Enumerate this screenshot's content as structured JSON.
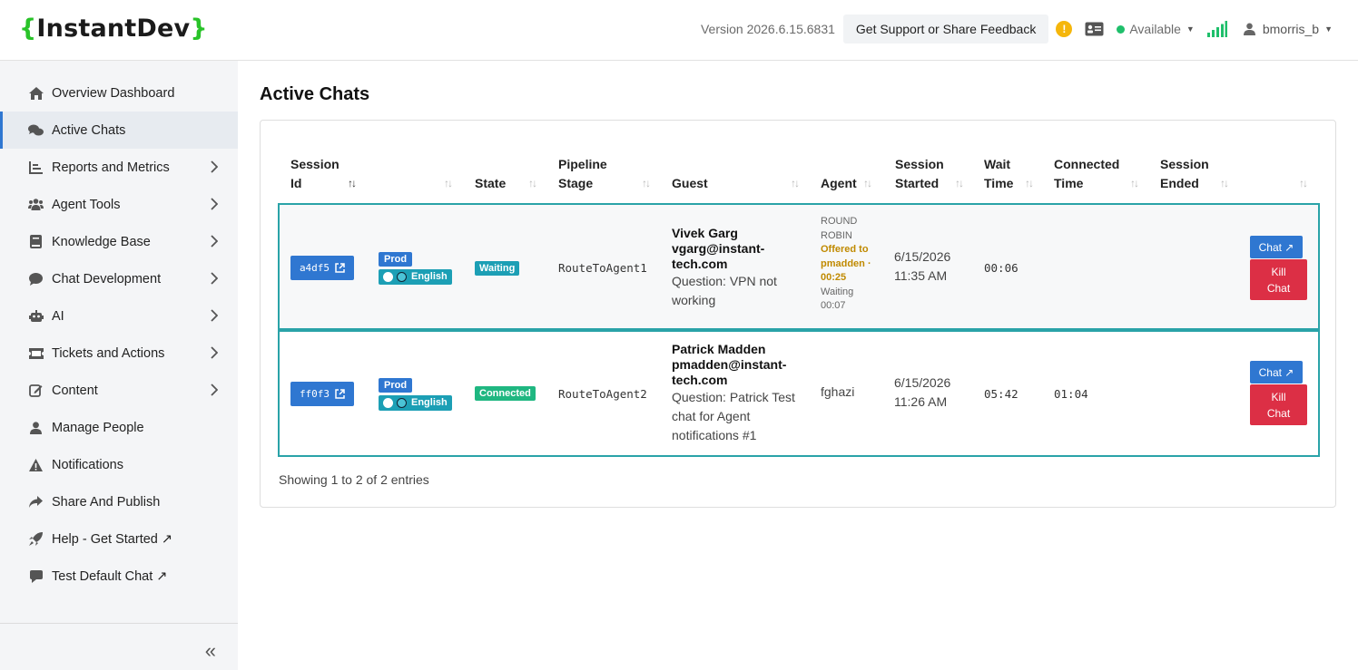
{
  "header": {
    "logo_open": "{",
    "logo_text": "InstantDev",
    "logo_close": "}",
    "version": "Version 2026.6.15.6831",
    "support_label": "Get Support or Share Feedback",
    "warn_glyph": "!",
    "status_label": "Available",
    "username": "bmorris_b",
    "colors": {
      "status_dot": "#1fbf6b",
      "warning": "#f5b60b",
      "signal": "#1fbf6b"
    }
  },
  "sidebar": {
    "items": [
      {
        "label": "Overview Dashboard",
        "icon": "home-icon"
      },
      {
        "label": "Active Chats",
        "icon": "chats-icon",
        "active": true
      },
      {
        "label": "Reports and Metrics",
        "icon": "chart-icon",
        "chevron": true
      },
      {
        "label": "Agent Tools",
        "icon": "users-icon",
        "chevron": true
      },
      {
        "label": "Knowledge Base",
        "icon": "book-icon",
        "chevron": true
      },
      {
        "label": "Chat Development",
        "icon": "chat-bubble-icon",
        "chevron": true
      },
      {
        "label": "AI",
        "icon": "robot-icon",
        "chevron": true
      },
      {
        "label": "Tickets and Actions",
        "icon": "ticket-icon",
        "chevron": true
      },
      {
        "label": "Content",
        "icon": "edit-icon",
        "chevron": true
      },
      {
        "label": "Manage People",
        "icon": "person-icon"
      },
      {
        "label": "Notifications",
        "icon": "warning-triangle-icon"
      },
      {
        "label": "Share And Publish",
        "icon": "share-icon"
      },
      {
        "label": "Help - Get Started ↗",
        "icon": "rocket-icon"
      },
      {
        "label": "Test Default Chat ↗",
        "icon": "message-icon"
      }
    ],
    "collapse_glyph": "«"
  },
  "main": {
    "title": "Active Chats",
    "columns": {
      "session_id_1": "Session",
      "session_id_2": "Id",
      "state": "State",
      "pipeline_1": "Pipeline",
      "pipeline_2": "Stage",
      "guest": "Guest",
      "agent": "Agent",
      "started_1": "Session",
      "started_2": "Started",
      "wait_1": "Wait",
      "wait_2": "Time",
      "connected_1": "Connected",
      "connected_2": "Time",
      "ended_1": "Session",
      "ended_2": "Ended"
    },
    "sort_glyph": "↑↓",
    "rows": [
      {
        "session_id": "a4df5",
        "env": "Prod",
        "language": "English",
        "state": "Waiting",
        "pipeline_stage": "RouteToAgent1",
        "guest_name": "Vivek Garg",
        "guest_email_1": "vgarg@instant-",
        "guest_email_2": "tech.com",
        "question": "Question: VPN not working",
        "agent_mode_1": "ROUND",
        "agent_mode_2": "ROBIN",
        "offer_1": "Offered to",
        "offer_2": "pmadden ·",
        "offer_3": "00:25",
        "waiting_1": "Waiting",
        "waiting_2": "00:07",
        "started_date": "6/15/2026",
        "started_time": "11:35 AM",
        "wait_time": "00:06",
        "connected_time": "",
        "chat_label": "Chat ↗",
        "kill_label_1": "Kill",
        "kill_label_2": "Chat"
      },
      {
        "session_id": "ff0f3",
        "env": "Prod",
        "language": "English",
        "state": "Connected",
        "pipeline_stage": "RouteToAgent2",
        "guest_name": "Patrick Madden",
        "guest_email_1": "pmadden@instant-",
        "guest_email_2": "tech.com",
        "question": "Question: Patrick Test chat for Agent notifications #1",
        "agent": "fghazi",
        "started_date": "6/15/2026",
        "started_time": "11:26 AM",
        "wait_time": "05:42",
        "connected_time": "01:04",
        "chat_label": "Chat ↗",
        "kill_label_1": "Kill",
        "kill_label_2": "Chat"
      }
    ],
    "showing": "Showing 1 to 2 of 2 entries"
  }
}
